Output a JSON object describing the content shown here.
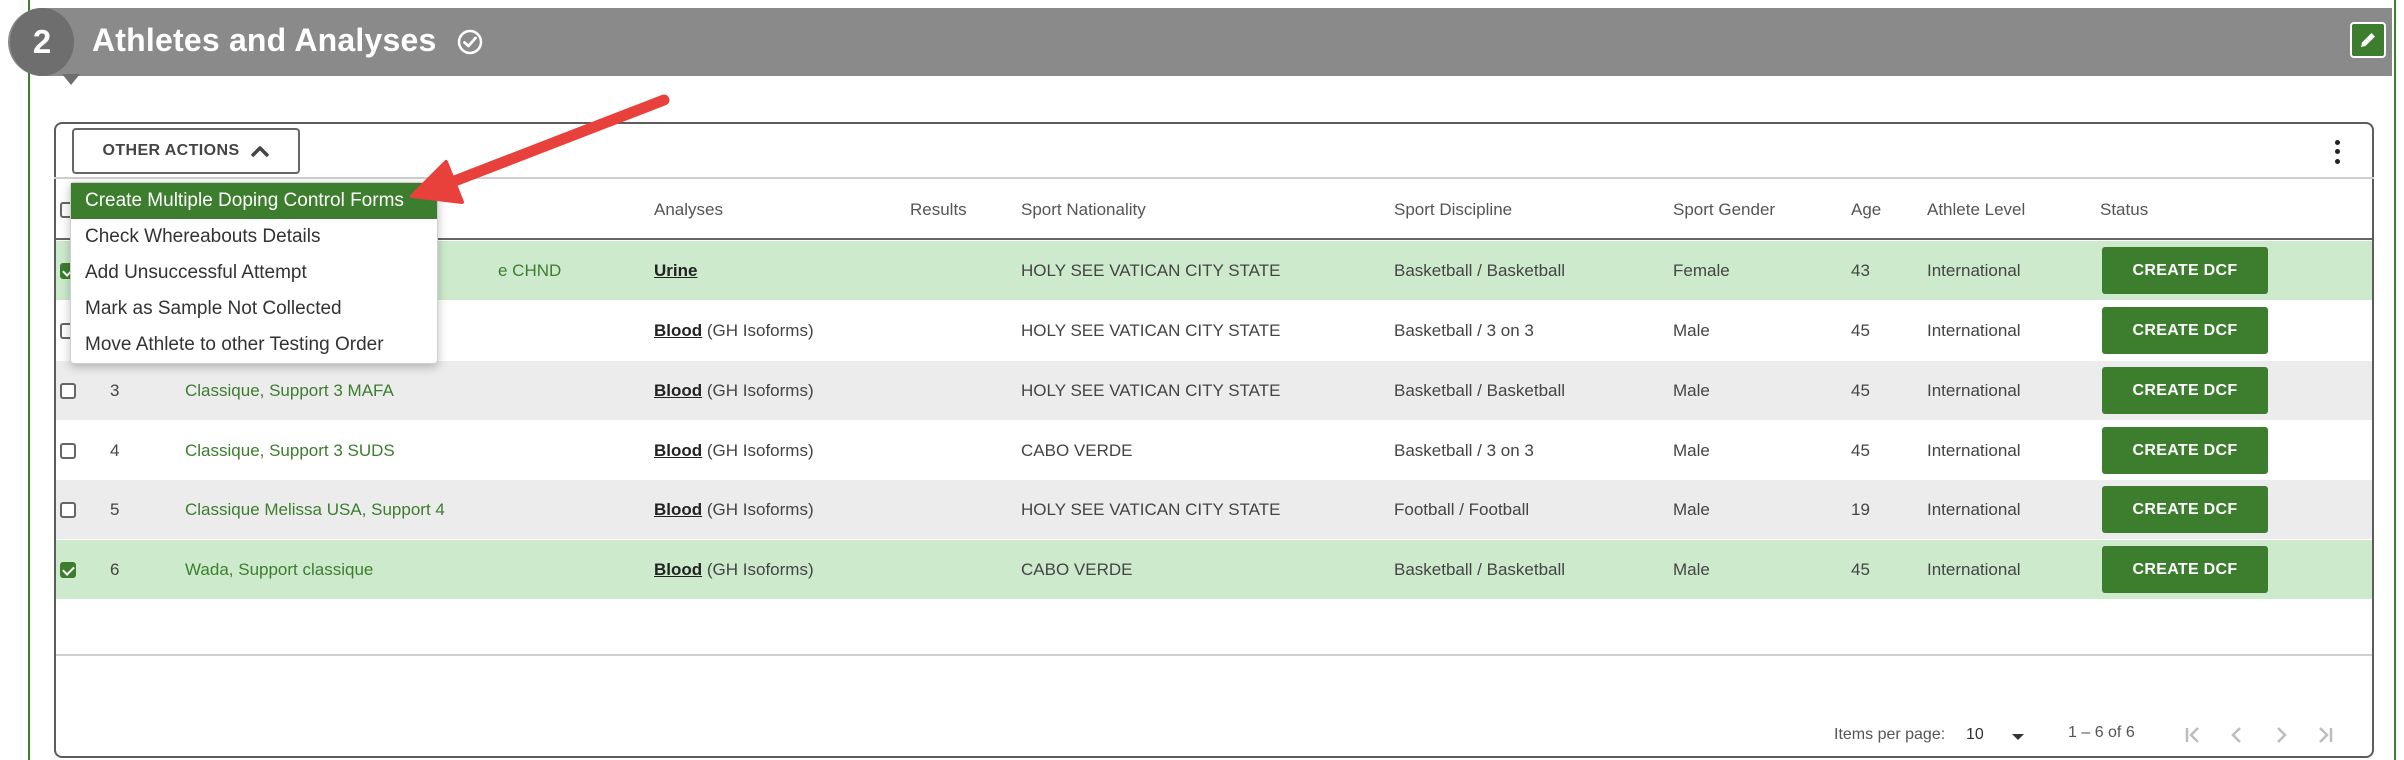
{
  "section": {
    "step": "2",
    "title": "Athletes and Analyses"
  },
  "toolbar": {
    "other_actions_label": "OTHER ACTIONS"
  },
  "menu": {
    "items": [
      "Create Multiple Doping Control Forms",
      "Check Whereabouts Details",
      "Add Unsuccessful Attempt",
      "Mark as Sample Not Collected",
      "Move Athlete to other Testing Order"
    ]
  },
  "table": {
    "headers": {
      "analyses": "Analyses",
      "results": "Results",
      "sport_nationality": "Sport Nationality",
      "sport_discipline": "Sport Discipline",
      "sport_gender": "Sport Gender",
      "age": "Age",
      "athlete_level": "Athlete Level",
      "status": "Status"
    },
    "rows": [
      {
        "index": "",
        "name": "e CHND",
        "analysis": "Urine",
        "analysis_detail": "",
        "nationality": "HOLY SEE VATICAN CITY STATE",
        "discipline": "Basketball / Basketball",
        "gender": "Female",
        "age": "43",
        "level": "International",
        "action": "CREATE DCF"
      },
      {
        "index": "",
        "name": "",
        "analysis": "Blood",
        "analysis_detail": "(GH Isoforms)",
        "nationality": "HOLY SEE VATICAN CITY STATE",
        "discipline": "Basketball / 3 on 3",
        "gender": "Male",
        "age": "45",
        "level": "International",
        "action": "CREATE DCF"
      },
      {
        "index": "3",
        "name": "Classique, Support 3 MAFA",
        "analysis": "Blood",
        "analysis_detail": "(GH Isoforms)",
        "nationality": "HOLY SEE VATICAN CITY STATE",
        "discipline": "Basketball / Basketball",
        "gender": "Male",
        "age": "45",
        "level": "International",
        "action": "CREATE DCF"
      },
      {
        "index": "4",
        "name": "Classique, Support 3 SUDS",
        "analysis": "Blood",
        "analysis_detail": "(GH Isoforms)",
        "nationality": "CABO VERDE",
        "discipline": "Basketball / 3 on 3",
        "gender": "Male",
        "age": "45",
        "level": "International",
        "action": "CREATE DCF"
      },
      {
        "index": "5",
        "name": "Classique Melissa USA, Support 4",
        "analysis": "Blood",
        "analysis_detail": "(GH Isoforms)",
        "nationality": "HOLY SEE VATICAN CITY STATE",
        "discipline": "Football / Football",
        "gender": "Male",
        "age": "19",
        "level": "International",
        "action": "CREATE DCF"
      },
      {
        "index": "6",
        "name": "Wada, Support classique",
        "analysis": "Blood",
        "analysis_detail": "(GH Isoforms)",
        "nationality": "CABO VERDE",
        "discipline": "Basketball / Basketball",
        "gender": "Male",
        "age": "45",
        "level": "International",
        "action": "CREATE DCF"
      }
    ]
  },
  "paginator": {
    "items_per_page_label": "Items per page:",
    "items_per_page_value": "10",
    "range": "1 – 6 of 6"
  },
  "colors": {
    "brand_green": "#3c7d2e",
    "selected_row": "#cdebcc",
    "header_gray": "#8a8a8a",
    "annotation_arrow": "#e8413c"
  }
}
